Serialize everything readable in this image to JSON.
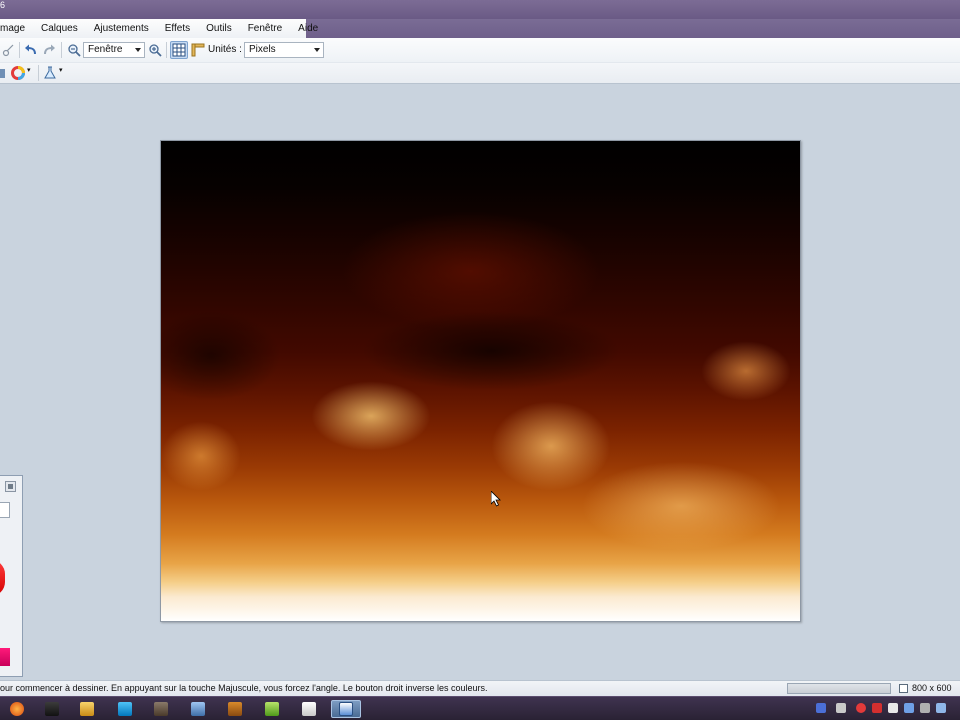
{
  "window": {
    "title_glyph": "6"
  },
  "menu": {
    "items": [
      "mage",
      "Calques",
      "Ajustements",
      "Effets",
      "Outils",
      "Fenêtre",
      "Aide"
    ]
  },
  "toolbar": {
    "zoom_select": "Fenêtre",
    "units_label": "Unités :",
    "units_select": "Pixels"
  },
  "statusbar": {
    "hint": "our commencer à dessiner. En appuyant sur la touche Majuscule, vous forcez l'angle. Le bouton droit inverse les couleurs.",
    "image_size": "800 x 600"
  },
  "icons": {
    "undo": "undo-icon",
    "redo": "redo-icon",
    "zoom_out": "zoom-out-icon",
    "zoom_in": "zoom-in-icon",
    "grid": "grid-icon",
    "ruler": "ruler-icon",
    "color_wheel": "color-wheel-icon",
    "flask": "flask-icon"
  },
  "colors": {
    "menu_bar": "#6e5f8a",
    "workspace": "#c9d3de",
    "taskbar": "#2a2234"
  }
}
